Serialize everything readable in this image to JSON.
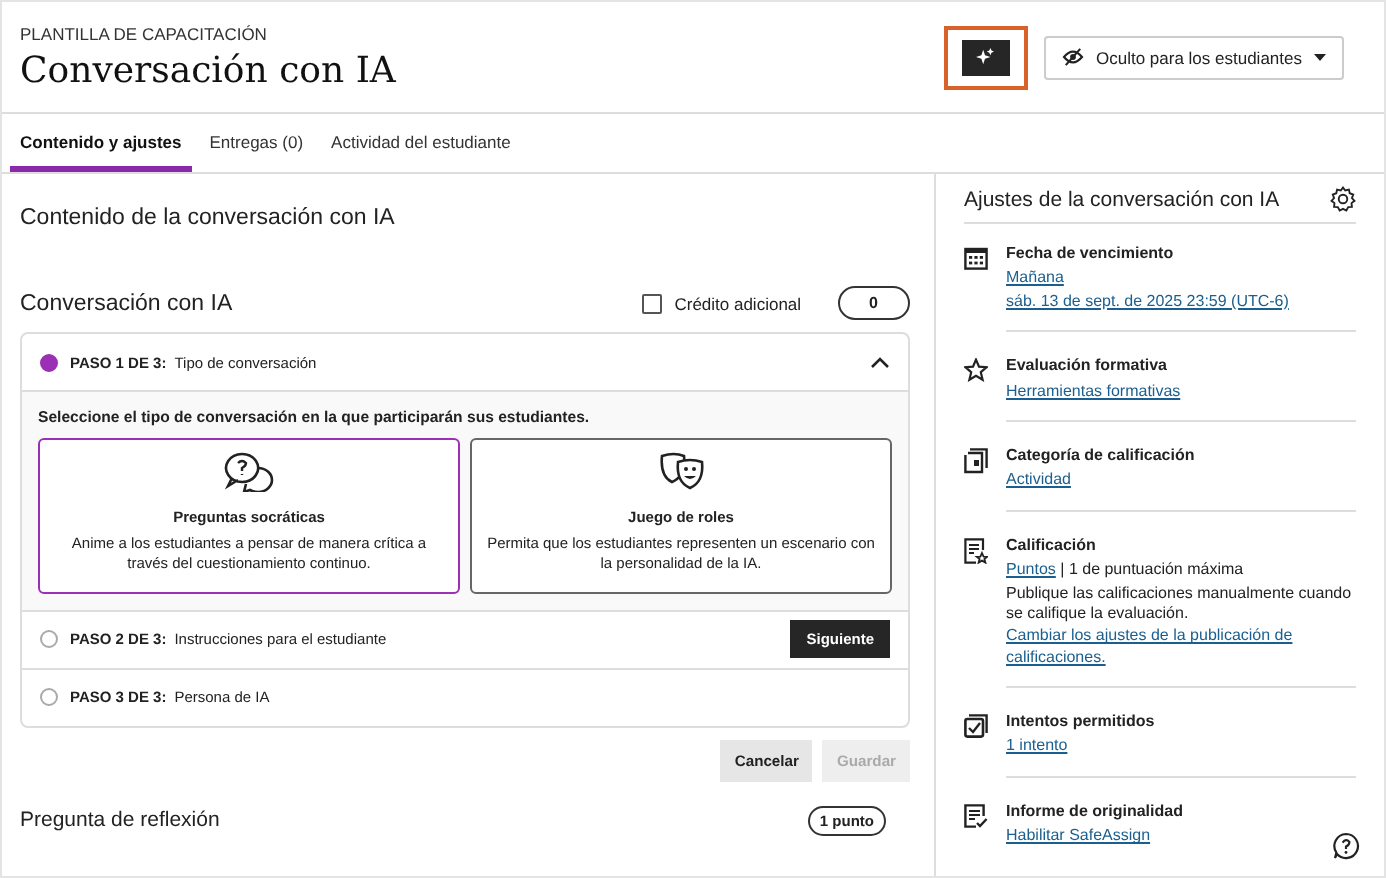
{
  "header": {
    "eyebrow": "PLANTILLA DE CAPACITACIÓN",
    "title": "Conversación con IA",
    "ai_button_highlighted": true,
    "visibility": "Oculto para los estudiantes"
  },
  "tabs": [
    {
      "label": "Contenido y ajustes",
      "selected": true
    },
    {
      "label": "Entregas (0)",
      "selected": false
    },
    {
      "label": "Actividad del estudiante",
      "selected": false
    }
  ],
  "content": {
    "heading": "Contenido de la conversación con IA",
    "section_title": "Conversación con IA",
    "extra_credit": {
      "label": "Crédito adicional",
      "checked": false
    },
    "points": "0",
    "steps": [
      {
        "label": "PASO 1 DE 3:",
        "title": "Tipo de conversación",
        "selected": true,
        "expanded": true
      },
      {
        "label": "PASO 2 DE 3:",
        "title": "Instrucciones para el estudiante",
        "selected": false,
        "expanded": false,
        "button": "Siguiente"
      },
      {
        "label": "PASO 3 DE 3:",
        "title": "Persona de IA",
        "selected": false,
        "expanded": false
      }
    ],
    "prompt": "Seleccione el tipo de conversación en la que participarán sus estudiantes.",
    "options": [
      {
        "kind": "questions",
        "title": "Preguntas socráticas",
        "description": "Anime a los estudiantes a pensar de manera crítica a través del cuestionamiento continuo.",
        "selected": true
      },
      {
        "kind": "masks",
        "title": "Juego de roles",
        "description": "Permita que los estudiantes representen un escenario con la personalidad de la IA.",
        "selected": false
      }
    ],
    "actions": [
      {
        "label": "Cancelar",
        "disabled": false
      },
      {
        "label": "Guardar",
        "disabled": true
      }
    ],
    "next_question": {
      "title": "Pregunta de reflexión",
      "points": "1 punto"
    }
  },
  "settings": {
    "title": "Ajustes de la conversación con IA",
    "items": [
      {
        "kind": "calendar",
        "title": "Fecha de vencimiento",
        "rows": [
          [
            {
              "text": "Mañana",
              "link": true
            }
          ],
          [
            {
              "text": "sáb. 13 de sept. de 2025 23:59 (UTC-6)",
              "link": true
            }
          ]
        ]
      },
      {
        "kind": "star",
        "title": "Evaluación formativa",
        "rows": [
          [
            {
              "text": "Herramientas formativas",
              "link": true
            }
          ]
        ]
      },
      {
        "kind": "category",
        "title": "Categoría de calificación",
        "rows": [
          [
            {
              "text": "Actividad",
              "link": true
            }
          ]
        ]
      },
      {
        "kind": "grade",
        "title": "Calificación",
        "rows": [
          [
            {
              "text": "Puntos",
              "link": true
            },
            {
              "text": "| 1 de puntuación máxima",
              "link": false
            }
          ],
          [
            {
              "text": "Publique las calificaciones manualmente cuando se califique la evaluación.",
              "link": false
            }
          ],
          [
            {
              "text": "Cambiar los ajustes de la publicación de calificaciones.",
              "link": true
            }
          ]
        ]
      },
      {
        "kind": "attempts",
        "title": "Intentos permitidos",
        "rows": [
          [
            {
              "text": "1 intento",
              "link": true
            }
          ]
        ]
      },
      {
        "kind": "report",
        "title": "Informe de originalidad",
        "rows": [
          [
            {
              "text": "Habilitar SafeAssign",
              "link": true
            }
          ]
        ]
      }
    ]
  }
}
